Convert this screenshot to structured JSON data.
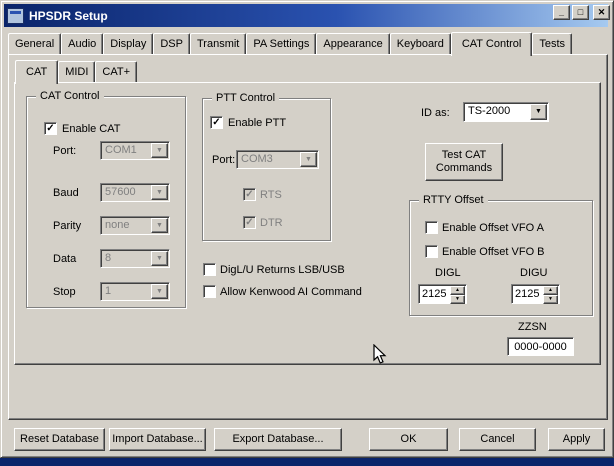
{
  "glyphs": {
    "check": "✓",
    "dropdown_arrow": "▼",
    "spinner_up": "▲",
    "spinner_down": "▼",
    "minimize": "_",
    "maximize": "□",
    "close": "✕"
  },
  "colors": {
    "titlebar_left": "#0a246a",
    "titlebar_right": "#a6caf0",
    "dialog_face": "#d4d0c8",
    "desktop": "#0a246a",
    "disabled_text": "#808080"
  },
  "window": {
    "title": "HPSDR Setup"
  },
  "main_tabs": {
    "active": "CAT Control",
    "items": [
      {
        "label": "General"
      },
      {
        "label": "Audio"
      },
      {
        "label": "Display"
      },
      {
        "label": "DSP"
      },
      {
        "label": "Transmit"
      },
      {
        "label": "PA Settings"
      },
      {
        "label": "Appearance"
      },
      {
        "label": "Keyboard"
      },
      {
        "label": "CAT Control"
      },
      {
        "label": "Tests"
      }
    ]
  },
  "sub_tabs": {
    "active": "CAT",
    "items": [
      {
        "label": "CAT"
      },
      {
        "label": "MIDI"
      },
      {
        "label": "CAT+"
      }
    ]
  },
  "cat_group": {
    "title": "CAT Control",
    "enable_label": "Enable CAT",
    "enable_checked": true,
    "rows": [
      {
        "label": "Port:",
        "value": "COM1",
        "enabled": false
      },
      {
        "label": "Baud",
        "value": "57600",
        "enabled": false
      },
      {
        "label": "Parity",
        "value": "none",
        "enabled": false
      },
      {
        "label": "Data",
        "value": "8",
        "enabled": false
      },
      {
        "label": "Stop",
        "value": "1",
        "enabled": false
      }
    ]
  },
  "ptt_group": {
    "title": "PTT Control",
    "enable_label": "Enable PTT",
    "enable_checked": true,
    "port_label": "Port:",
    "port_value": "COM3",
    "port_enabled": false,
    "rts_label": "RTS",
    "rts_checked": true,
    "dtr_label": "DTR",
    "dtr_checked": true
  },
  "options": {
    "diglu_label": "DigL/U Returns LSB/USB",
    "diglu_checked": false,
    "kenwood_label": "Allow Kenwood AI Command",
    "kenwood_checked": false
  },
  "id_as": {
    "label": "ID as:",
    "value": "TS-2000"
  },
  "test_cat": {
    "line1": "Test CAT",
    "line2": "Commands"
  },
  "rtty_group": {
    "title": "RTTY Offset",
    "vfo_a_label": "Enable Offset VFO A",
    "vfo_a_checked": false,
    "vfo_b_label": "Enable Offset VFO B",
    "vfo_b_checked": false,
    "digl_label": "DIGL",
    "digu_label": "DIGU",
    "digl_value": "2125",
    "digu_value": "2125"
  },
  "zzsn": {
    "label": "ZZSN",
    "value": "0000-0000"
  },
  "footer": {
    "reset_label": "Reset Database",
    "import_label": "Import Database...",
    "export_label": "Export Database...",
    "ok_label": "OK",
    "cancel_label": "Cancel",
    "apply_label": "Apply"
  }
}
